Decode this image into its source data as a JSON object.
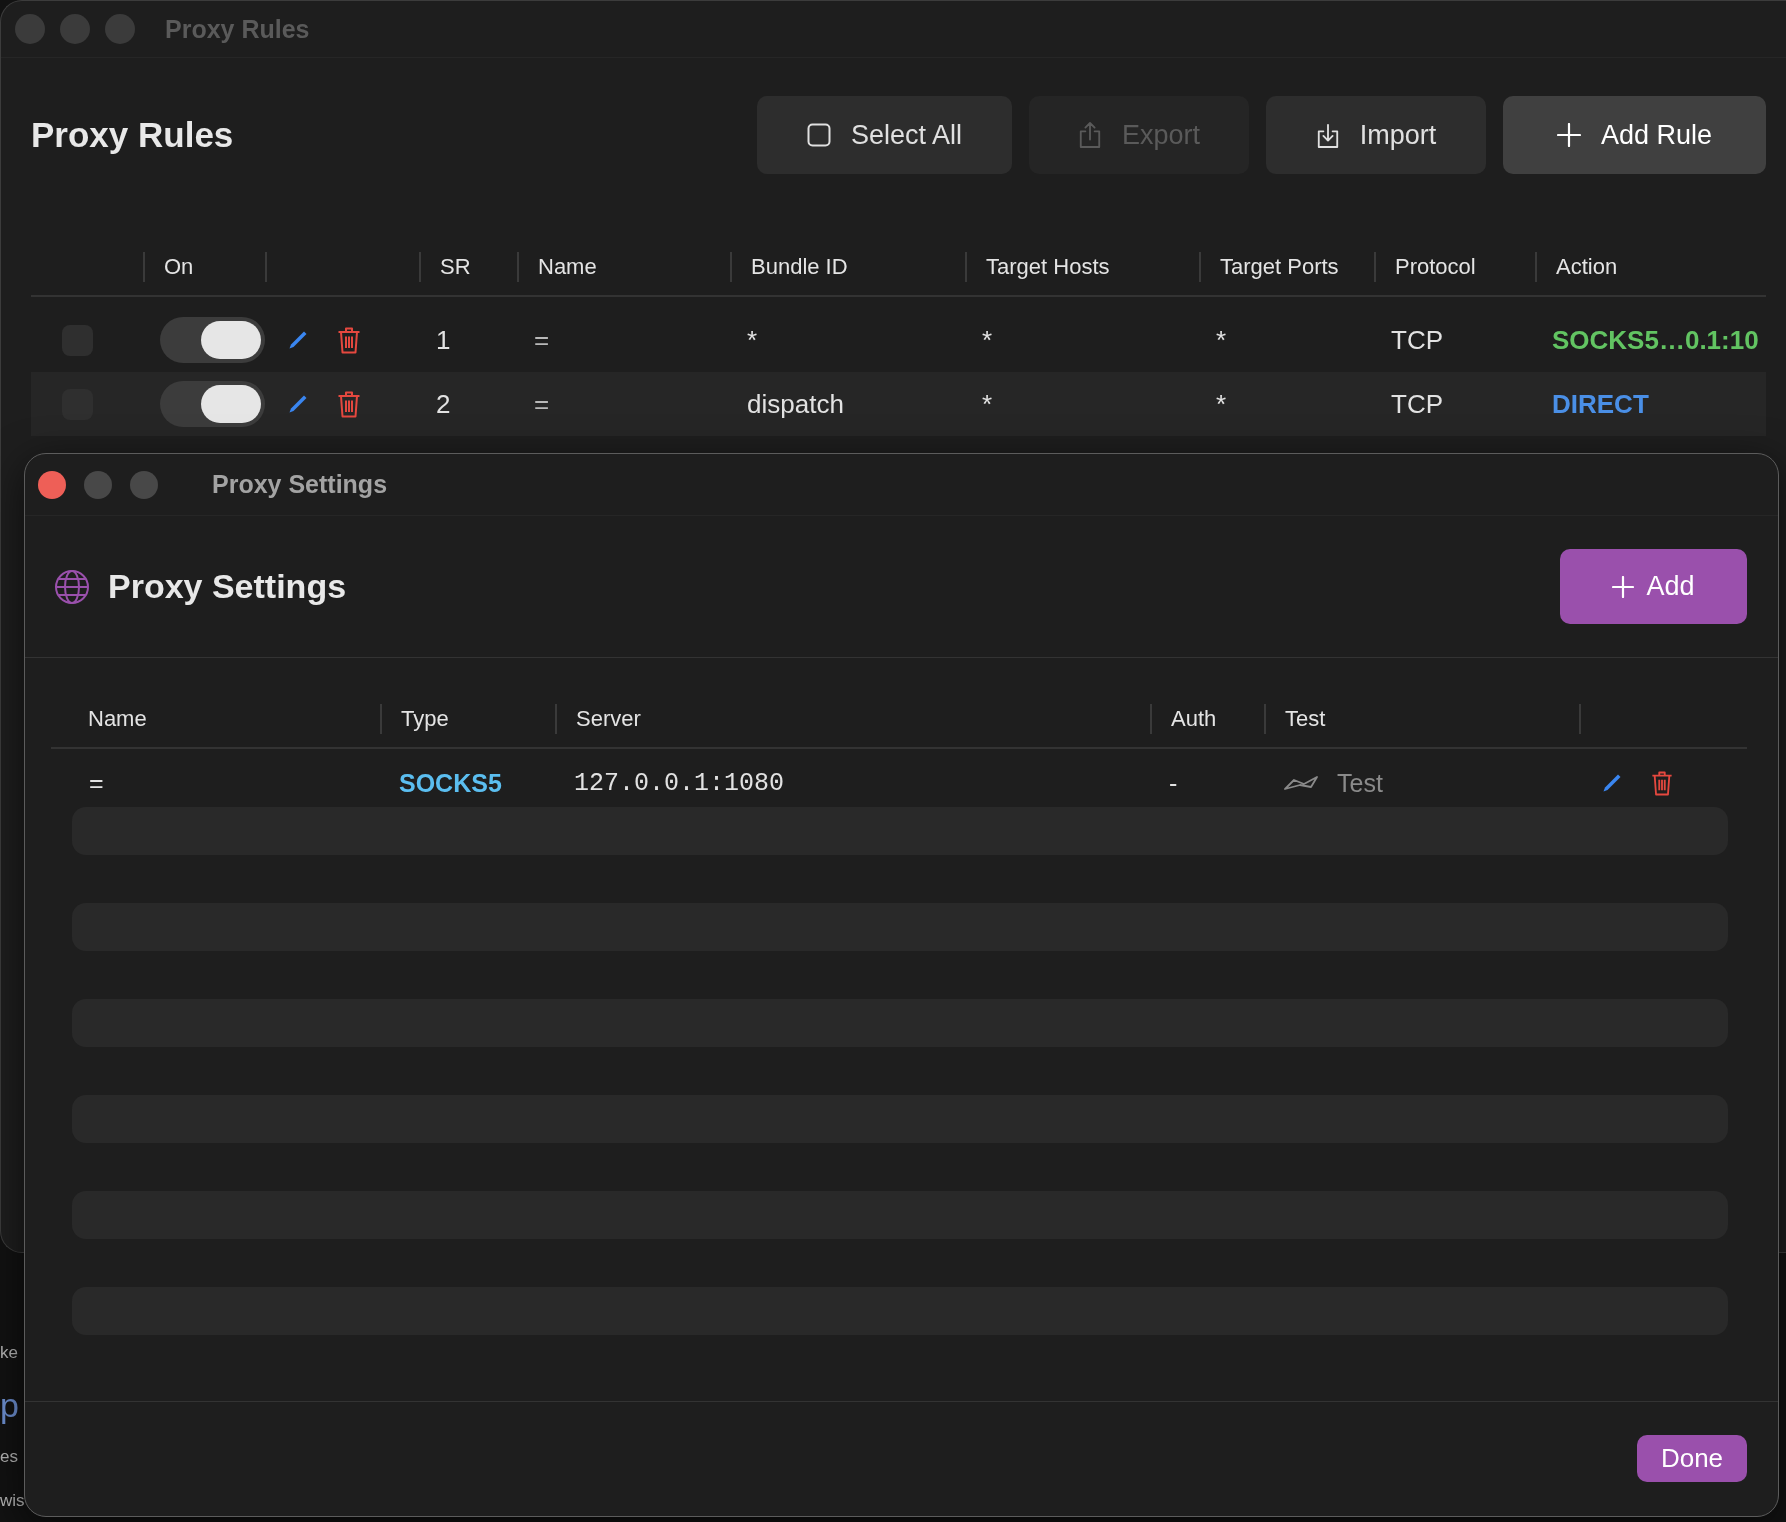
{
  "main_window": {
    "title": "Proxy Rules",
    "active": false
  },
  "rules_header": {
    "heading": "Proxy Rules",
    "buttons": [
      {
        "kind": "select_all",
        "label": "Select All",
        "disabled": false,
        "primary": false
      },
      {
        "kind": "export",
        "label": "Export",
        "disabled": true,
        "primary": false
      },
      {
        "kind": "import",
        "label": "Import",
        "disabled": false,
        "primary": false
      },
      {
        "kind": "add",
        "label": "Add Rule",
        "disabled": false,
        "primary": true
      }
    ]
  },
  "rules_table": {
    "columns": [
      "On",
      "SR",
      "Name",
      "Bundle ID",
      "Target Hosts",
      "Target Ports",
      "Protocol",
      "Action"
    ],
    "rows": [
      {
        "selected": false,
        "on": true,
        "sr": "1",
        "name": "=",
        "bundle_id": "*",
        "target_hosts": "*",
        "target_ports": "*",
        "protocol": "TCP",
        "action": {
          "text": "SOCKS5…0.1:10",
          "color": "#62c462"
        }
      },
      {
        "selected": false,
        "on": true,
        "sr": "2",
        "name": "=",
        "bundle_id": "dispatch",
        "target_hosts": "*",
        "target_ports": "*",
        "protocol": "TCP",
        "action": {
          "text": "DIRECT",
          "color": "#4a8fe6"
        }
      }
    ]
  },
  "background_window": {
    "fragments": [
      {
        "text": "ke",
        "kind": "plain"
      },
      {
        "text": "p",
        "kind": "link"
      },
      {
        "text": "es",
        "kind": "plain"
      },
      {
        "text": "wis",
        "kind": "plain"
      }
    ]
  },
  "settings_window": {
    "title": "Proxy Settings",
    "active": true,
    "heading": "Proxy Settings",
    "add_button": "Add",
    "columns": [
      "Name",
      "Type",
      "Server",
      "Auth",
      "Test"
    ],
    "rows": [
      {
        "name": "=",
        "type": {
          "text": "SOCKS5",
          "color": "#5bbef0"
        },
        "server": "127.0.0.1:1080",
        "auth": "-",
        "test_button": "Test"
      }
    ],
    "done_button": "Done"
  }
}
